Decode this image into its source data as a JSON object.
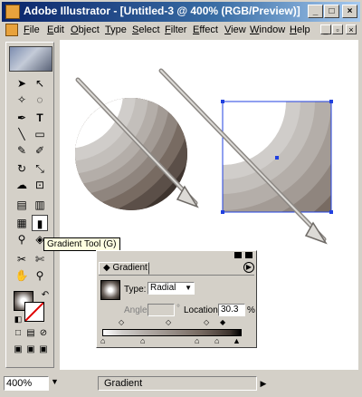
{
  "window": {
    "title": "Adobe Illustrator - [Untitled-3 @ 400% (RGB/Preview)]",
    "controls": {
      "minimize": "_",
      "maximize": "□",
      "close": "×"
    }
  },
  "menubar": {
    "items": [
      "File",
      "Edit",
      "Object",
      "Type",
      "Select",
      "Filter",
      "Effect",
      "View",
      "Window",
      "Help"
    ]
  },
  "toolbox": {
    "tools": [
      {
        "name": "selection",
        "glyph": "➤"
      },
      {
        "name": "direct-selection",
        "glyph": "↖"
      },
      {
        "name": "magic-wand",
        "glyph": "✧"
      },
      {
        "name": "lasso",
        "glyph": "◌"
      },
      {
        "name": "pen",
        "glyph": "✒"
      },
      {
        "name": "type",
        "glyph": "T"
      },
      {
        "name": "line",
        "glyph": "╲"
      },
      {
        "name": "rectangle",
        "glyph": "▭"
      },
      {
        "name": "paintbrush",
        "glyph": "✎"
      },
      {
        "name": "pencil",
        "glyph": "✐"
      },
      {
        "name": "rotate",
        "glyph": "↻"
      },
      {
        "name": "scale",
        "glyph": "⤡"
      },
      {
        "name": "warp",
        "glyph": "☁"
      },
      {
        "name": "free-transform",
        "glyph": "⊡"
      },
      {
        "name": "symbol-sprayer",
        "glyph": "▤"
      },
      {
        "name": "column-graph",
        "glyph": "▥"
      },
      {
        "name": "mesh",
        "glyph": "▦"
      },
      {
        "name": "gradient",
        "glyph": "▮"
      },
      {
        "name": "eyedropper",
        "glyph": "⚲"
      },
      {
        "name": "blend",
        "glyph": "◈"
      },
      {
        "name": "scissors",
        "glyph": "✂"
      },
      {
        "name": "knife",
        "glyph": "✄"
      },
      {
        "name": "hand",
        "glyph": "✋"
      },
      {
        "name": "zoom",
        "glyph": "⚲"
      }
    ]
  },
  "tooltip": "Gradient Tool (G)",
  "gradient_panel": {
    "tab_label": "Gradient",
    "type_label": "Type:",
    "type_value": "Radial",
    "angle_label": "Angle:",
    "angle_value": "",
    "degree_symbol": "°",
    "location_label": "Location:",
    "location_value": "30.3",
    "percent_symbol": "%"
  },
  "statusbar": {
    "zoom": "400%",
    "status": "Gradient"
  },
  "colors": {
    "titlebar": "#0a246a",
    "chrome": "#d4d0c8",
    "selection_blue": "#2040e0"
  }
}
